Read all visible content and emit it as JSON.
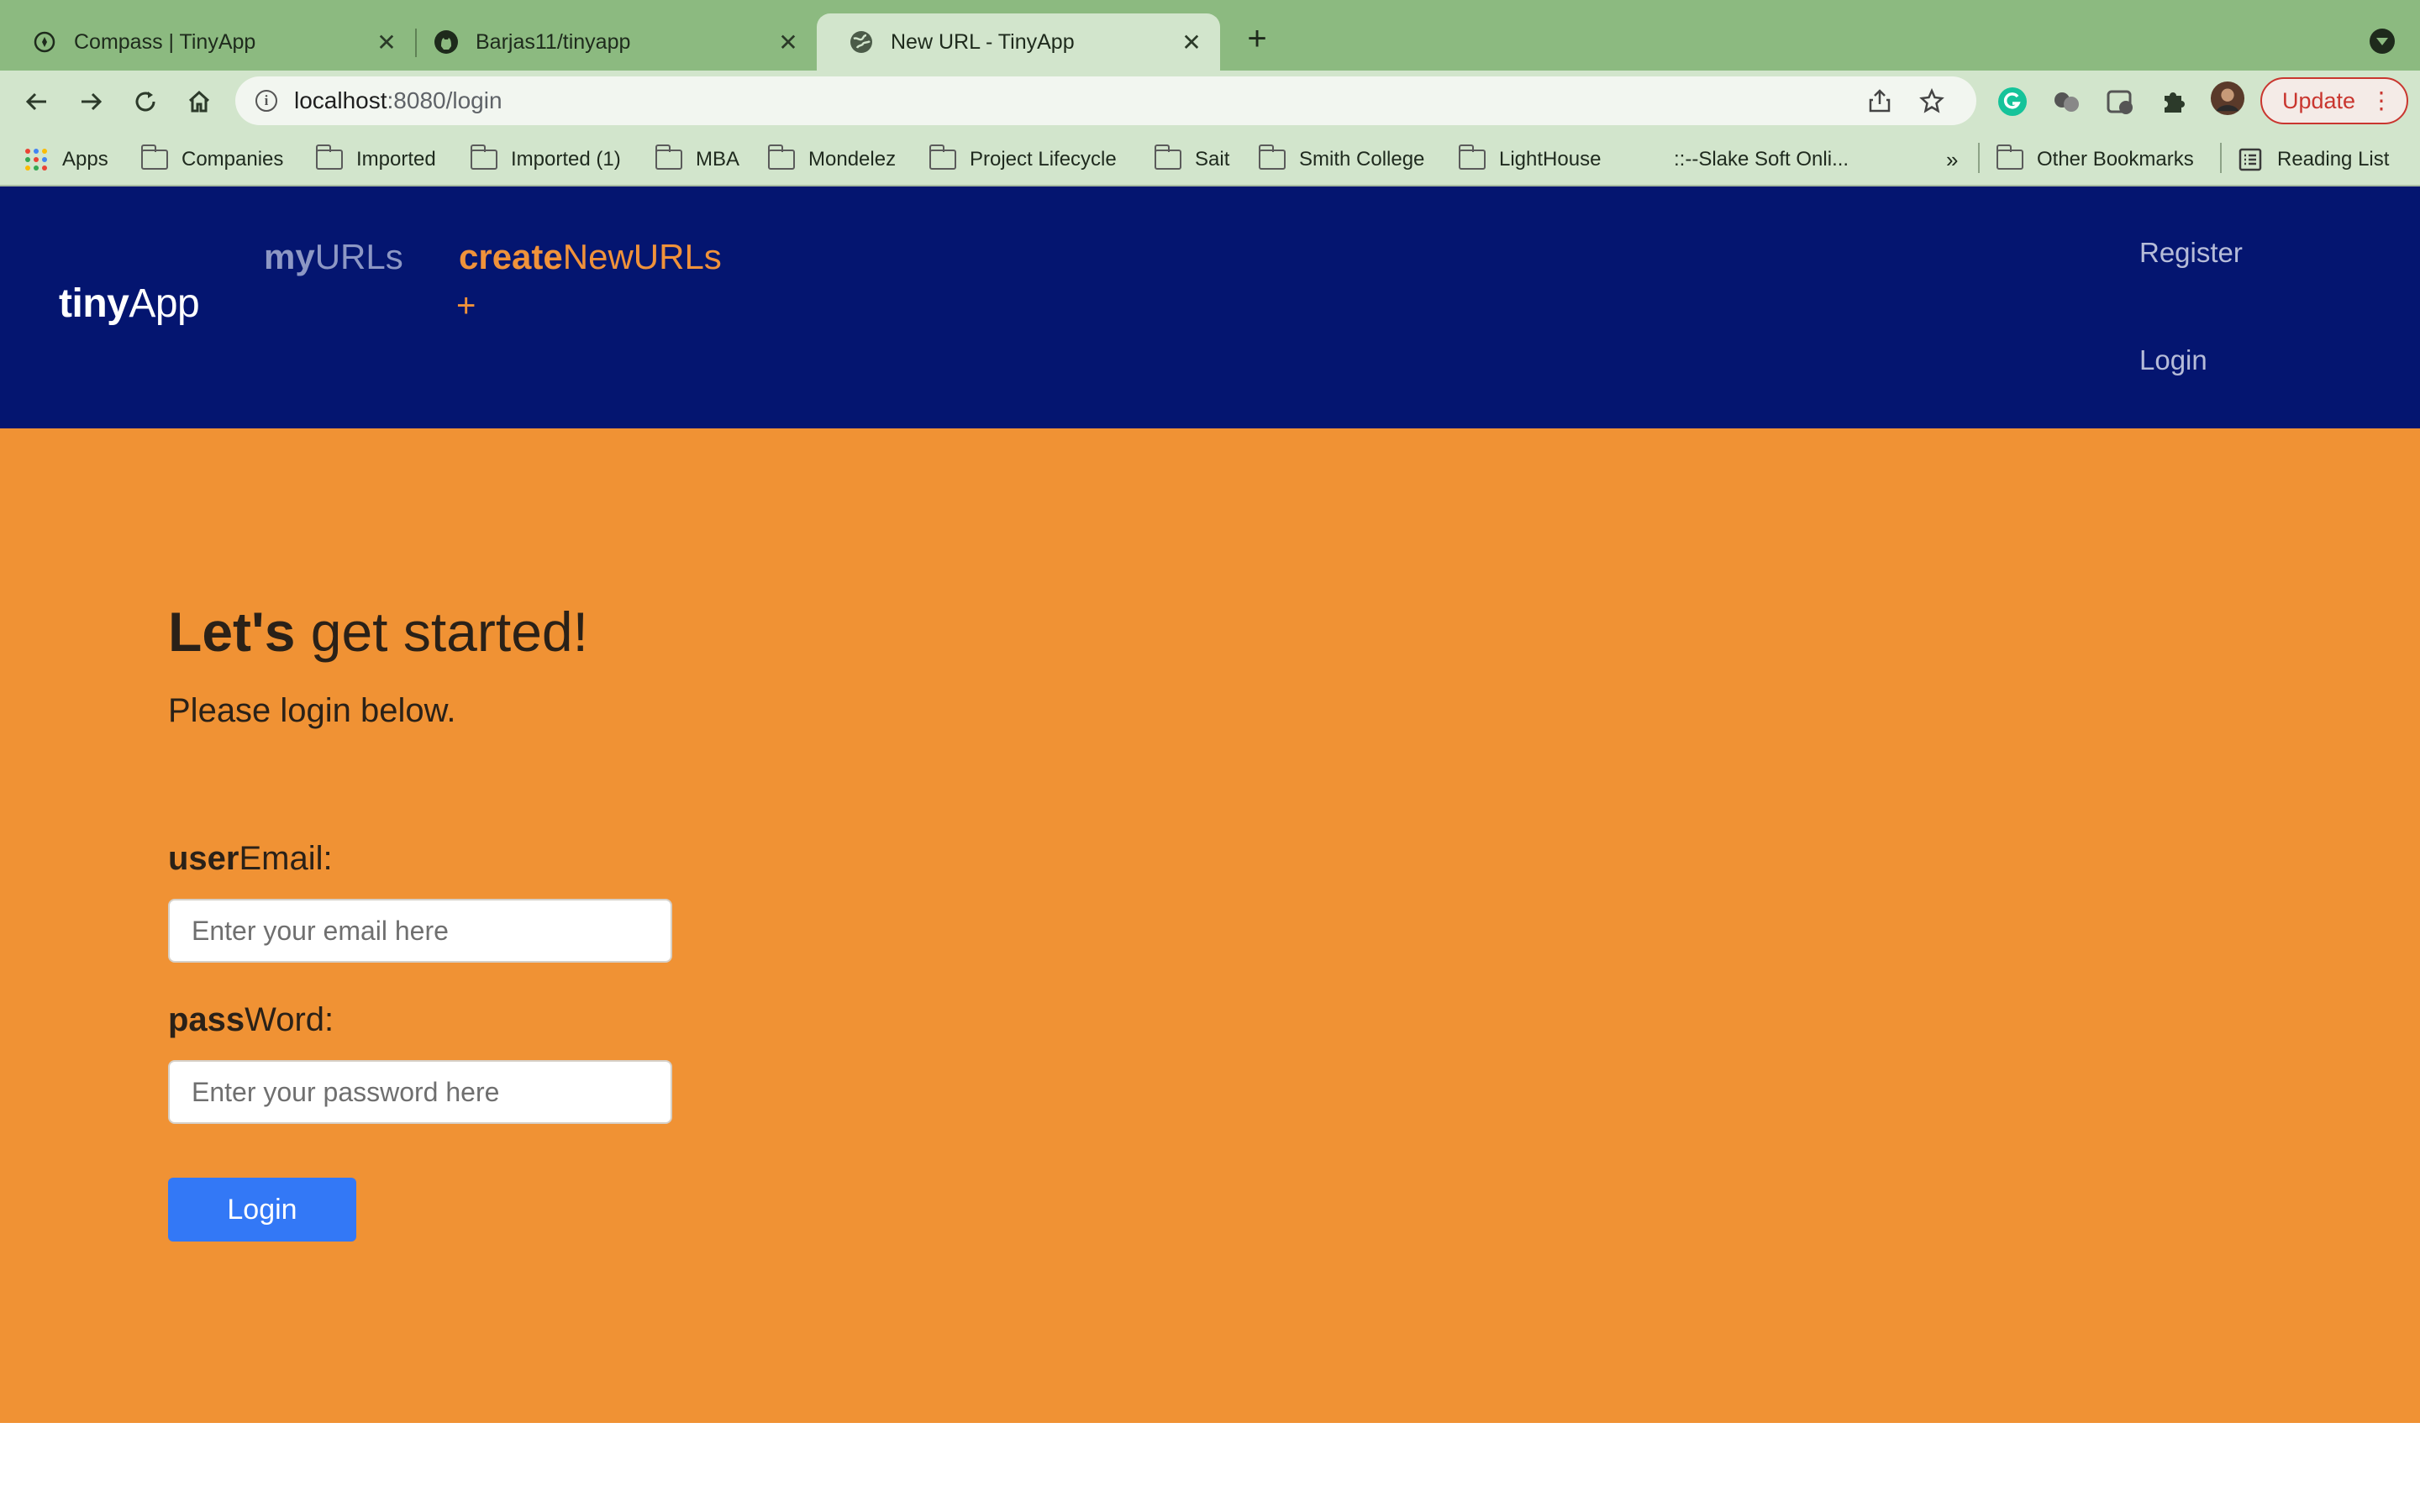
{
  "browser": {
    "tabs": [
      {
        "title": "Compass | TinyApp",
        "icon": "compass-icon",
        "active": false
      },
      {
        "title": "Barjas11/tinyapp",
        "icon": "github-icon",
        "active": false
      },
      {
        "title": "New URL - TinyApp",
        "icon": "globe-icon",
        "active": true
      }
    ],
    "tab_close": "✕",
    "new_tab": "+",
    "address": {
      "host": "localhost",
      "rest": ":8080/login"
    },
    "update_label": "Update",
    "bookmarks": [
      {
        "label": "Apps",
        "type": "apps"
      },
      {
        "label": "Companies",
        "type": "folder"
      },
      {
        "label": "Imported",
        "type": "folder"
      },
      {
        "label": "Imported (1)",
        "type": "folder"
      },
      {
        "label": "MBA",
        "type": "folder"
      },
      {
        "label": "Mondelez",
        "type": "folder"
      },
      {
        "label": "Project Lifecycle",
        "type": "folder"
      },
      {
        "label": "Sait",
        "type": "folder"
      },
      {
        "label": "Smith College",
        "type": "folder"
      },
      {
        "label": "LightHouse",
        "type": "folder"
      },
      {
        "label": "::--Slake Soft Onli...",
        "type": "link"
      },
      {
        "label": "»",
        "type": "overflow"
      },
      {
        "label": "Other Bookmarks",
        "type": "folder"
      },
      {
        "label": "Reading List",
        "type": "reading-list"
      }
    ]
  },
  "nav": {
    "brand_bold": "tiny",
    "brand_rest": "App",
    "myurls_bold": "my",
    "myurls_rest": "URLs",
    "create_bold": "create",
    "create_rest": "NewURLs",
    "create_plus": "+",
    "register": "Register",
    "login": "Login"
  },
  "main": {
    "title_bold": "Let's",
    "title_rest": " get started!",
    "subtitle": "Please login below.",
    "email_label_bold": "user",
    "email_label_rest": "Email:",
    "email_placeholder": "Enter your email here",
    "password_label_bold": "pass",
    "password_label_rest": "Word:",
    "password_placeholder": "Enter your password here",
    "login_button": "Login"
  },
  "colors": {
    "tabbar": "#8cba80",
    "navbar": "#041570",
    "hero": "#f09234",
    "accent": "#f0923a",
    "button": "#3378f6",
    "update": "#c9362f"
  }
}
